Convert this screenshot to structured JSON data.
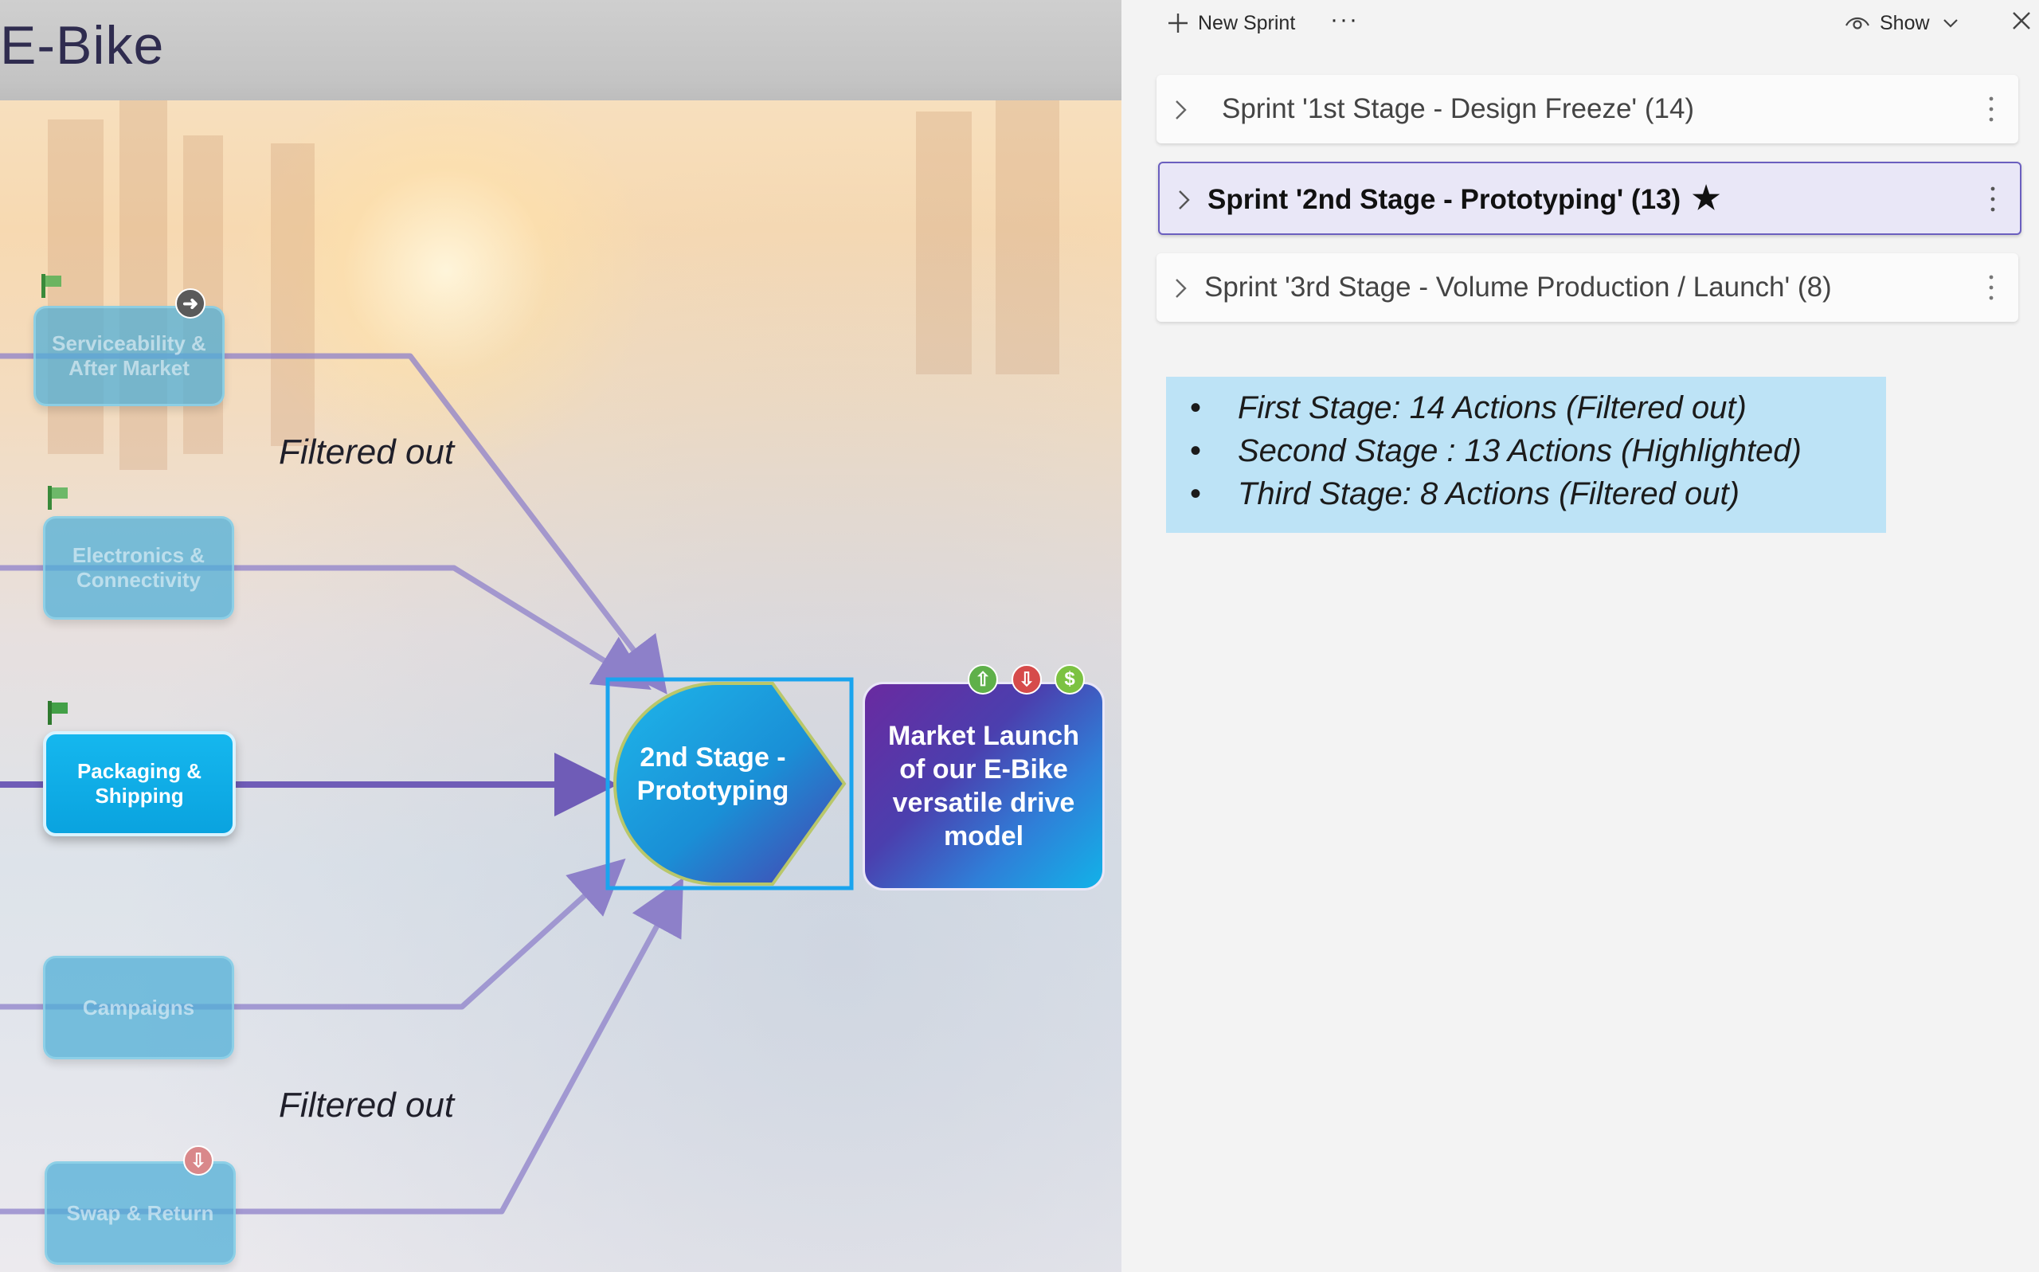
{
  "canvas": {
    "title": "E-Bike",
    "nodes": {
      "serviceability": "Serviceability & After Market",
      "electronics": "Electronics & Connectivity",
      "packaging": "Packaging & Shipping",
      "campaigns": "Campaigns",
      "swap": "Swap & Return",
      "stage2": "2nd Stage - Prototyping",
      "market": "Market Launch of our E-Bike versatile drive model"
    },
    "annotations": {
      "top": "Filtered out",
      "bottom": "Filtered out"
    },
    "badges": {
      "up": "⇧",
      "down": "⇩",
      "dollar": "$"
    },
    "colors": {
      "flow_line": "#6f5cb7",
      "flow_line_faded": "#8d80c9",
      "node_active": "#0aa3df",
      "selection": "#1aa4ee",
      "market_start": "#6a2aa0",
      "market_end": "#12b2e8"
    }
  },
  "panel": {
    "toolbar": {
      "new_sprint": "New Sprint",
      "more": "···",
      "show": "Show",
      "icons": [
        "plus-icon",
        "more-icon",
        "eye-icon",
        "chevron-down-icon",
        "close-icon"
      ]
    },
    "sprints": [
      {
        "label": "Sprint '1st Stage - Design Freeze' (14)",
        "selected": false
      },
      {
        "label": "Sprint '2nd Stage - Prototyping' (13)",
        "selected": true,
        "starred": true
      },
      {
        "label": "Sprint '3rd Stage - Volume Production / Launch' (8)",
        "selected": false
      }
    ],
    "notes": [
      "First Stage: 14 Actions (Filtered out)",
      "Second Stage : 13 Actions (Highlighted)",
      "Third Stage: 8 Actions (Filtered out)"
    ],
    "colors": {
      "selected_row_bg": "#e9e7f7",
      "selected_row_border": "#6b5fbf",
      "note_bg": "#bde3f6"
    }
  }
}
